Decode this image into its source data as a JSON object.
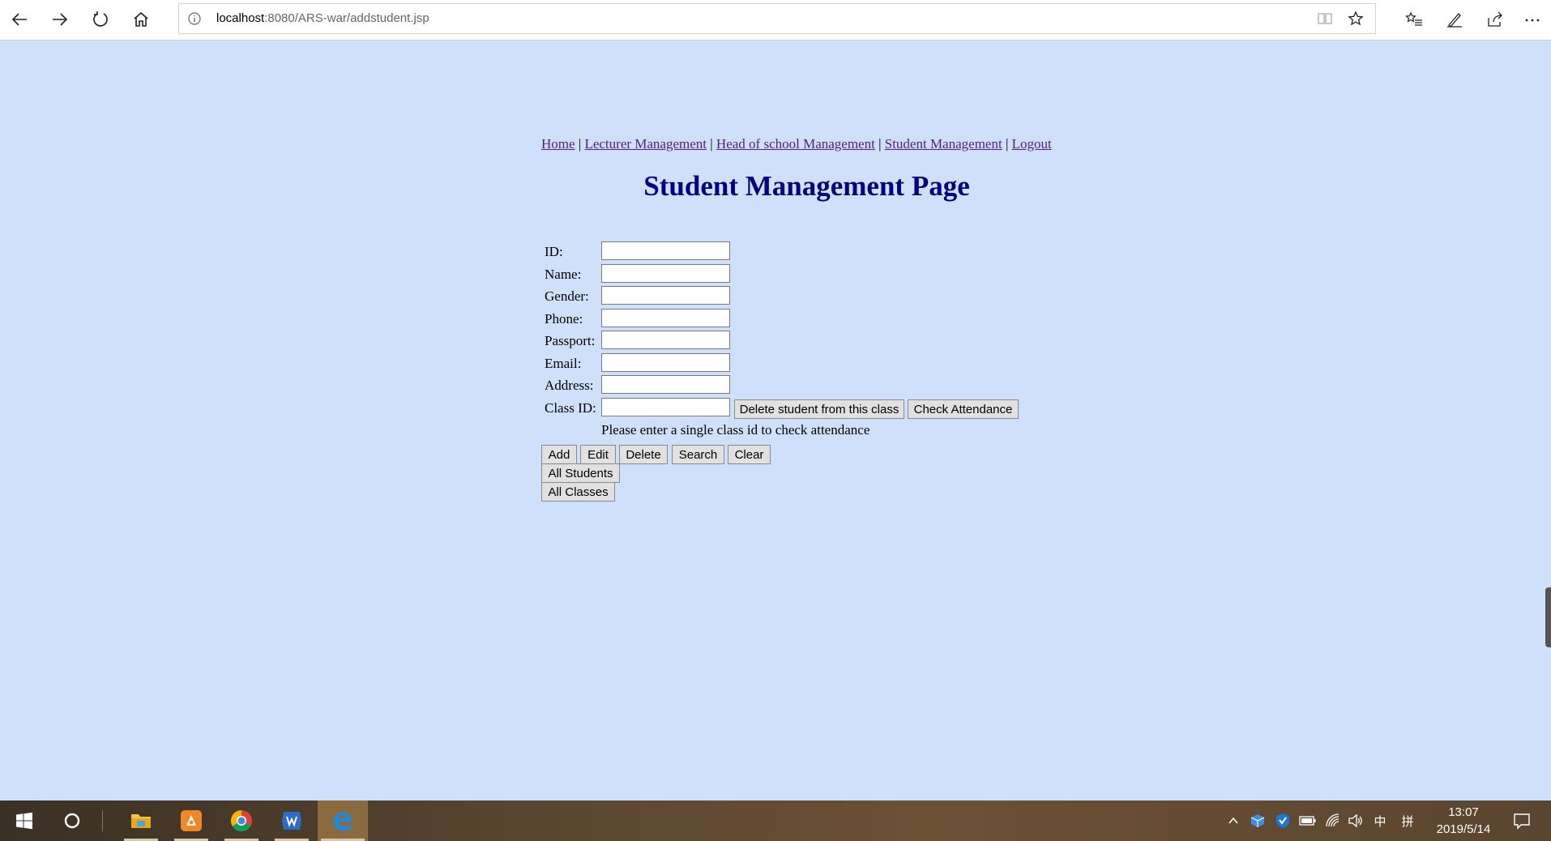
{
  "browser": {
    "url_host": "localhost",
    "url_rest": ":8080/ARS-war/addstudent.jsp"
  },
  "menu": {
    "items": [
      "Home",
      "Lecturer Management",
      "Head of school Management",
      "Student Management",
      "Logout"
    ],
    "separator": "|"
  },
  "page": {
    "title": "Student Management Page"
  },
  "form": {
    "fields": [
      {
        "label": "ID:",
        "value": ""
      },
      {
        "label": "Name:",
        "value": ""
      },
      {
        "label": "Gender:",
        "value": ""
      },
      {
        "label": "Phone:",
        "value": ""
      },
      {
        "label": "Passport:",
        "value": ""
      },
      {
        "label": "Email:",
        "value": ""
      },
      {
        "label": "Address:",
        "value": ""
      },
      {
        "label": "Class ID:",
        "value": ""
      }
    ],
    "class_buttons": {
      "delete_from_class": "Delete student from this class",
      "check_attendance": "Check Attendance"
    },
    "hint": "Please enter a single class id to check attendance",
    "actions": [
      "Add",
      "Edit",
      "Delete",
      "Search",
      "Clear"
    ],
    "all_students": "All Students",
    "all_classes": "All Classes"
  },
  "taskbar": {
    "time": "13:07",
    "date": "2019/5/14",
    "ime_lang": "中",
    "ime_mode": "拼"
  }
}
